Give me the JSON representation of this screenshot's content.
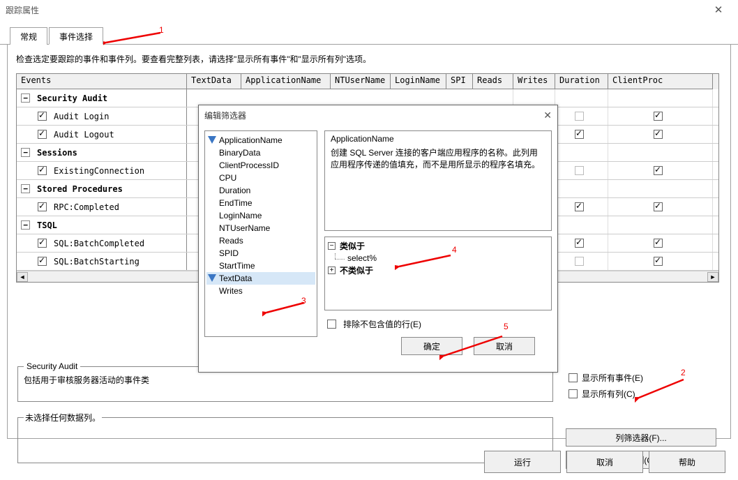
{
  "window": {
    "title": "跟踪属性"
  },
  "tabs": {
    "general": "常规",
    "events": "事件选择"
  },
  "instruction": "检查选定要跟踪的事件和事件列。要查看完整列表，请选择\"显示所有事件\"和\"显示所有列\"选项。",
  "grid": {
    "headers": {
      "events": "Events",
      "textdata": "TextData",
      "appname": "ApplicationName",
      "ntuser": "NTUserName",
      "loginname": "LoginName",
      "spi": "SPI",
      "reads": "Reads",
      "writes": "Writes",
      "duration": "Duration",
      "clientproc": "ClientProc"
    },
    "rows": [
      {
        "type": "group",
        "label": "Security Audit"
      },
      {
        "type": "item",
        "label": "Audit Login",
        "wr": false,
        "du": false,
        "cp": true
      },
      {
        "type": "item",
        "label": "Audit Logout",
        "wr": true,
        "du": true,
        "cp": true
      },
      {
        "type": "group",
        "label": "Sessions"
      },
      {
        "type": "item",
        "label": "ExistingConnection",
        "wr": false,
        "du": false,
        "cp": true
      },
      {
        "type": "group",
        "label": "Stored Procedures"
      },
      {
        "type": "item",
        "label": "RPC:Completed",
        "wr": true,
        "du": true,
        "cp": true
      },
      {
        "type": "group",
        "label": "TSQL"
      },
      {
        "type": "item",
        "label": "SQL:BatchCompleted",
        "wr": true,
        "du": true,
        "cp": true
      },
      {
        "type": "item",
        "label": "SQL:BatchStarting",
        "wr": false,
        "du": false,
        "cp": true
      }
    ]
  },
  "secaudit": {
    "legend": "Security Audit",
    "text": "包括用于审核服务器活动的事件类"
  },
  "rightopts": {
    "show_all_events": "显示所有事件(E)",
    "show_all_cols": "显示所有列(C)"
  },
  "nosel": {
    "legend": "未选择任何数据列。"
  },
  "sidebuttons": {
    "colfilter": "列筛选器(F)...",
    "orgcols": "组织列(O)..."
  },
  "bottom": {
    "run": "运行",
    "cancel": "取消",
    "help": "帮助"
  },
  "modal": {
    "title": "编辑筛选器",
    "items": {
      "i0": "ApplicationName",
      "i1": "BinaryData",
      "i2": "ClientProcessID",
      "i3": "CPU",
      "i4": "Duration",
      "i5": "EndTime",
      "i6": "LoginName",
      "i7": "NTUserName",
      "i8": "Reads",
      "i9": "SPID",
      "i10": "StartTime",
      "i11": "TextData",
      "i12": "Writes"
    },
    "desc": {
      "title": "ApplicationName",
      "body": "创建 SQL Server 连接的客户端应用程序的名称。此列用应用程序传递的值填充，而不是用所显示的程序名填充。"
    },
    "tree": {
      "like": "类似于",
      "value": "select%",
      "notlike": "不类似于"
    },
    "exclude": "排除不包含值的行(E)",
    "ok": "确定",
    "cancel": "取消"
  },
  "annotations": {
    "n1": "1",
    "n2": "2",
    "n3": "3",
    "n4": "4",
    "n5": "5"
  }
}
